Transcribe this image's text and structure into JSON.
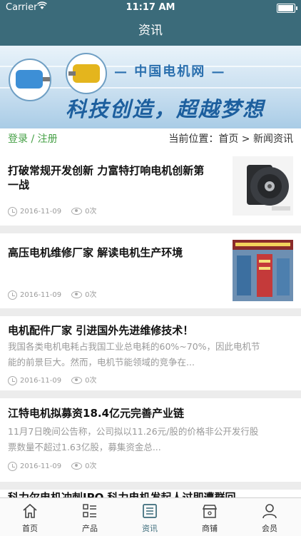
{
  "status_bar": {
    "carrier": "Carrier",
    "time": "11:17 AM",
    "battery_level": 0.95
  },
  "nav": {
    "title": "资讯"
  },
  "banner": {
    "brand": "— 中国电机网 —",
    "slogan": "科技创造，超越梦想"
  },
  "location": {
    "login_link": "登录 / 注册",
    "breadcrumb": "当前位置：首页 > 新闻资讯"
  },
  "articles": [
    {
      "title_line1": "打破常规开发创新 力富特打响电机创新第",
      "title_line2": "一战",
      "date": "2016-11-09",
      "views": "0次",
      "thumbnail": "motor-photo"
    },
    {
      "title_line1": "高压电机维修厂家 解读电机生产环境",
      "date": "2016-11-09",
      "views": "0次",
      "thumbnail": "factory-photo"
    },
    {
      "title_line1": "电机配件厂家 引进国外先进维修技术！",
      "summary_line1": "我国各类电机电耗占我国工业总电耗的60%~70%，因此电机节",
      "summary_line2": "能的前景巨大。然而，电机节能领域的竞争在...",
      "date": "2016-11-09",
      "views": "0次"
    },
    {
      "title_line1": "江特电机拟募资18.4亿元完善产业链",
      "summary_line1": "11月7日晚间公告称，公司拟以11.26元/股的价格非公开发行股",
      "summary_line2": "票数量不超过1.63亿股，募集资金总...",
      "date": "2016-11-09",
      "views": "0次"
    },
    {
      "title_line1": "科力尔电机冲刺IPO 科力电机发起人过即遭群回"
    }
  ],
  "tabs": [
    {
      "label": "首页",
      "icon": "home-icon"
    },
    {
      "label": "产品",
      "icon": "list-icon"
    },
    {
      "label": "资讯",
      "icon": "news-icon",
      "active": true
    },
    {
      "label": "商铺",
      "icon": "shop-icon"
    },
    {
      "label": "会员",
      "icon": "user-icon"
    }
  ],
  "colors": {
    "nav_bg": "#3b6b7a",
    "login_green": "#46a046",
    "active_tab": "#3b6b7a"
  }
}
